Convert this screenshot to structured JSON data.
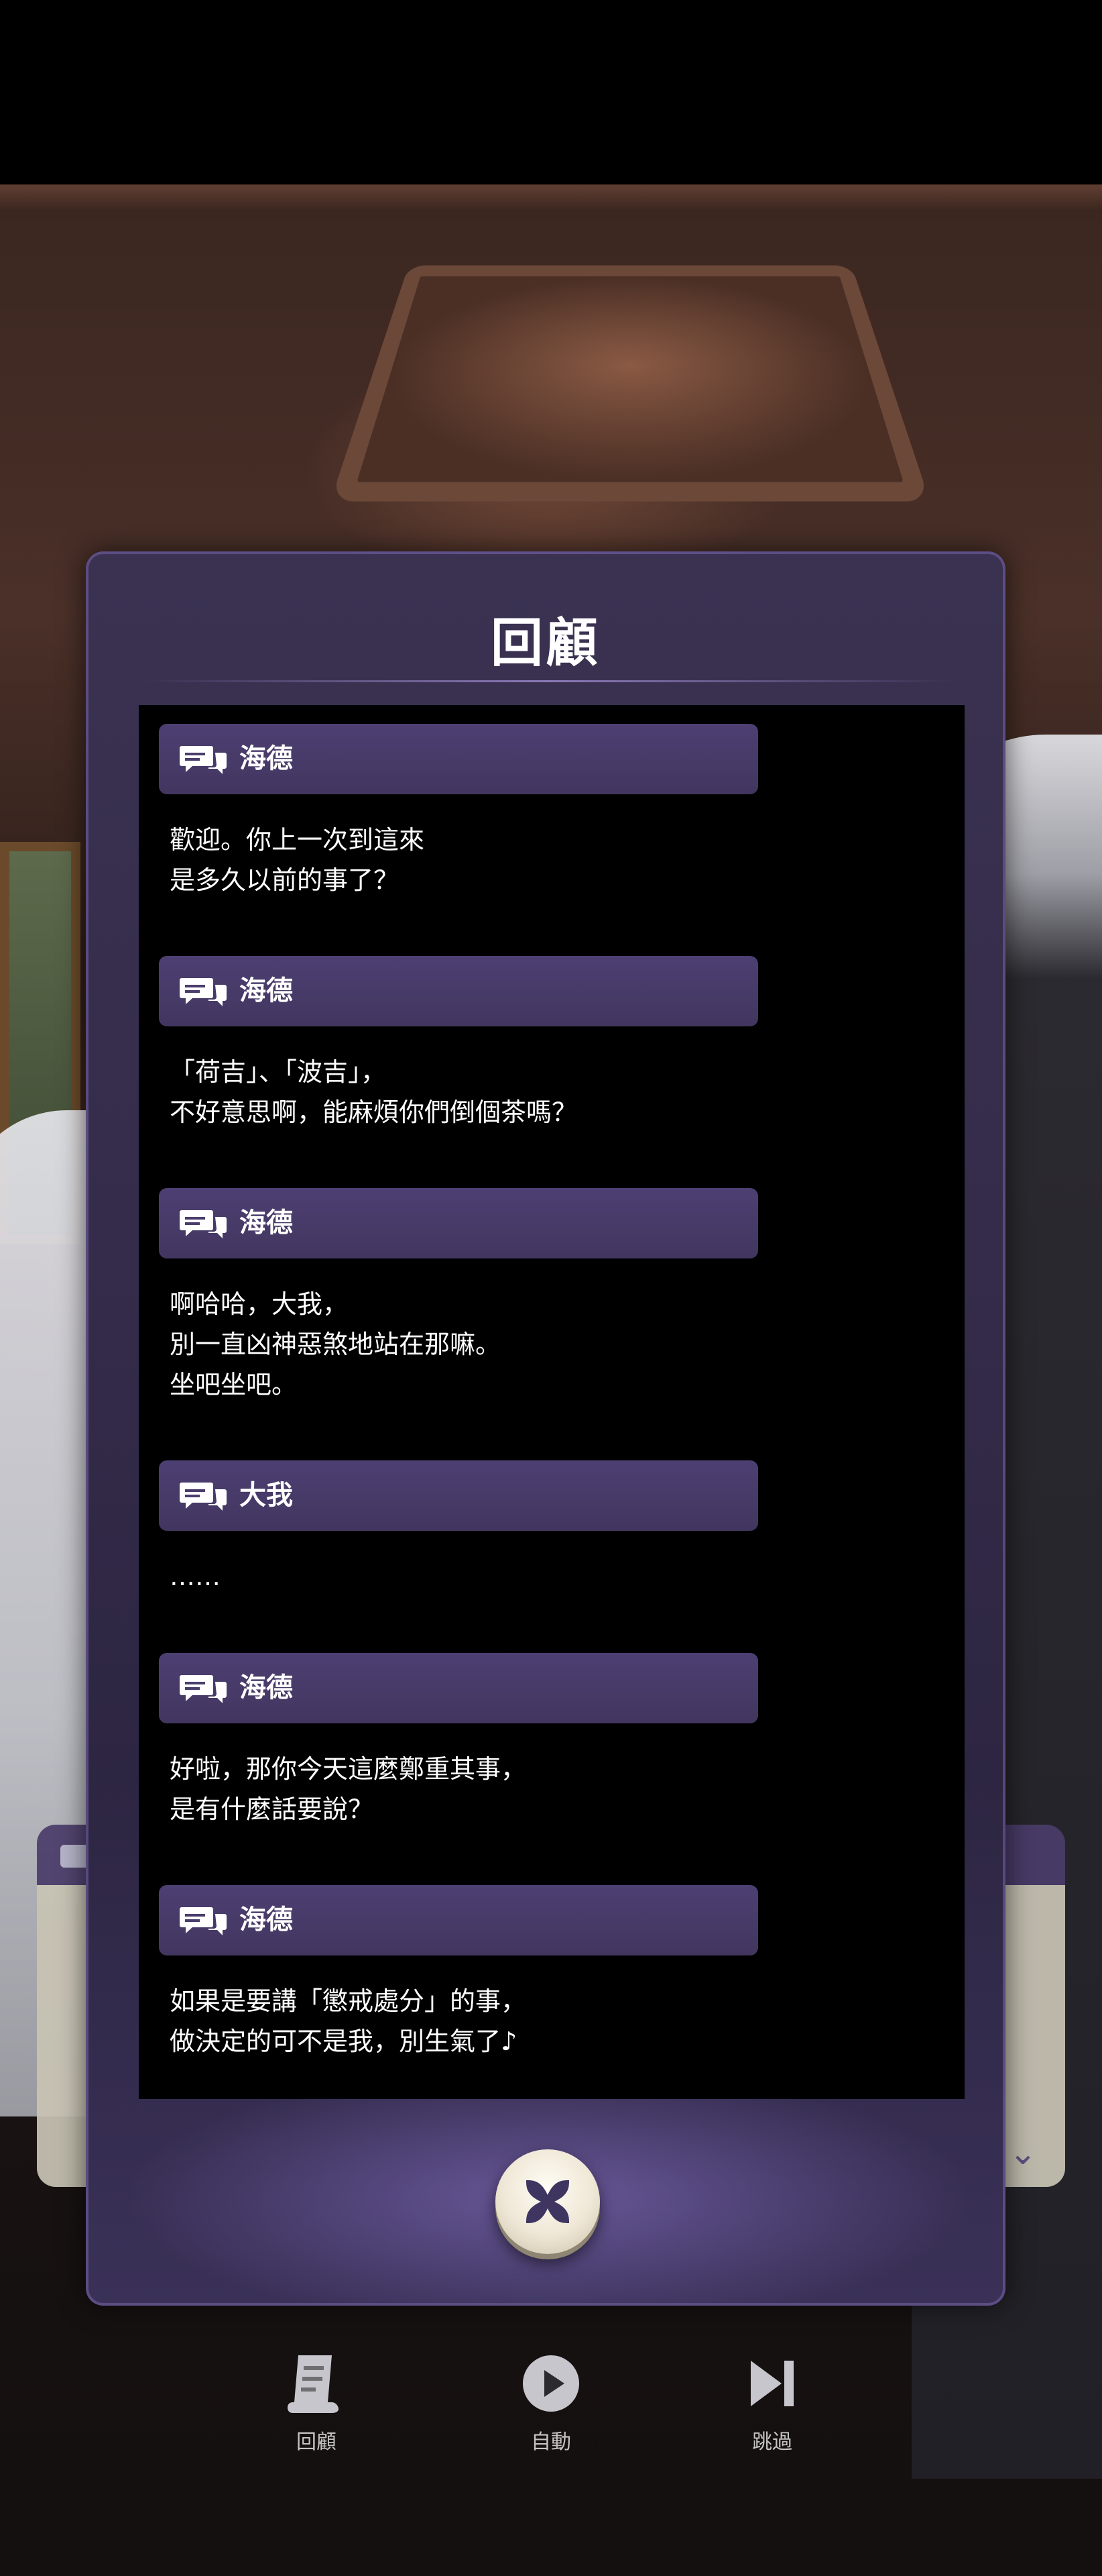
{
  "panel": {
    "title": "回顧"
  },
  "log_entries": [
    {
      "speaker": "海德",
      "lines": [
        "歡迎。你上一次到這來",
        "是多久以前的事了？"
      ]
    },
    {
      "speaker": "海德",
      "lines": [
        "「荷吉」、「波吉」，",
        "不好意思啊，能麻煩你們倒個茶嗎？"
      ]
    },
    {
      "speaker": "海德",
      "lines": [
        "啊哈哈，大我，",
        "別一直凶神惡煞地站在那嘛。",
        "坐吧坐吧。"
      ]
    },
    {
      "speaker": "大我",
      "lines": [
        "……"
      ]
    },
    {
      "speaker": "海德",
      "lines": [
        "好啦，那你今天這麼鄭重其事，",
        "是有什麼話要說？"
      ]
    },
    {
      "speaker": "海德",
      "lines": [
        "如果是要講「懲戒處分」的事，",
        "做決定的可不是我，別生氣了♪"
      ]
    }
  ],
  "bottom_nav": {
    "log_label": "回顧",
    "auto_label": "自動",
    "skip_label": "跳過"
  },
  "colors": {
    "name_bar": "#4a3d6c",
    "panel": "#342c4a",
    "log_bg": "#000000"
  },
  "icons": {
    "speaker": "chat-bubble-icon",
    "close": "close-x-icon",
    "log": "scroll-icon",
    "auto": "play-icon",
    "skip": "skip-forward-icon"
  }
}
